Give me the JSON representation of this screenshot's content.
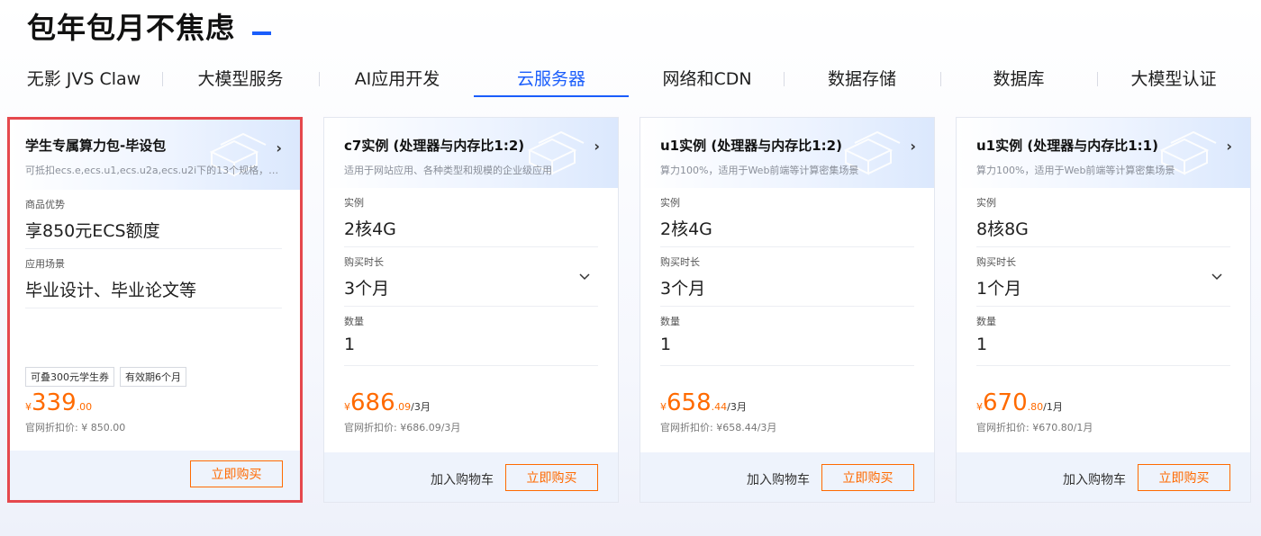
{
  "page": {
    "title": "包年包月不焦虑",
    "accent_color": "#1a5dfb",
    "price_color": "#ff6a00"
  },
  "tabs": [
    {
      "label": "无影 JVS Claw",
      "active": false
    },
    {
      "label": "大模型服务",
      "active": false
    },
    {
      "label": "AI应用开发",
      "active": false
    },
    {
      "label": "云服务器",
      "active": true
    },
    {
      "label": "网络和CDN",
      "active": false
    },
    {
      "label": "数据存储",
      "active": false
    },
    {
      "label": "数据库",
      "active": false
    },
    {
      "label": "大模型认证",
      "active": false
    }
  ],
  "cards": [
    {
      "title": "学生专属算力包-毕设包",
      "subtitle": "可抵扣ecs.e,ecs.u1,ecs.u2a,ecs.u2i下的13个规格，最...",
      "fields": [
        {
          "label": "商品优势",
          "value": "享850元ECS额度"
        },
        {
          "label": "应用场景",
          "value": "毕业设计、毕业论文等"
        }
      ],
      "tags": [
        "可叠300元学生券",
        "有效期6个月"
      ],
      "price": {
        "currency": "¥",
        "int": "339",
        "dec": ".00",
        "unit": ""
      },
      "list_price": "官网折扣价: ¥ 850.00",
      "buy_label": "立即购买"
    },
    {
      "title": "c7实例 (处理器与内存比1:2)",
      "subtitle": "适用于网站应用、各种类型和规模的企业级应用",
      "fields": [
        {
          "label": "实例",
          "value": "2核4G"
        },
        {
          "label": "购买时长",
          "value": "3个月"
        },
        {
          "label": "数量",
          "value": "1"
        }
      ],
      "price": {
        "currency": "¥",
        "int": "686",
        "dec": ".09",
        "unit": "/3月"
      },
      "list_price": "官网折扣价: ¥686.09/3月",
      "cart_label": "加入购物车",
      "buy_label": "立即购买"
    },
    {
      "title": "u1实例 (处理器与内存比1:2)",
      "subtitle": "算力100%，适用于Web前端等计算密集场景",
      "fields": [
        {
          "label": "实例",
          "value": "2核4G"
        },
        {
          "label": "购买时长",
          "value": "3个月"
        },
        {
          "label": "数量",
          "value": "1"
        }
      ],
      "price": {
        "currency": "¥",
        "int": "658",
        "dec": ".44",
        "unit": "/3月"
      },
      "list_price": "官网折扣价: ¥658.44/3月",
      "cart_label": "加入购物车",
      "buy_label": "立即购买"
    },
    {
      "title": "u1实例 (处理器与内存比1:1)",
      "subtitle": "算力100%，适用于Web前端等计算密集场景",
      "fields": [
        {
          "label": "实例",
          "value": "8核8G"
        },
        {
          "label": "购买时长",
          "value": "1个月"
        },
        {
          "label": "数量",
          "value": "1"
        }
      ],
      "price": {
        "currency": "¥",
        "int": "670",
        "dec": ".80",
        "unit": "/1月"
      },
      "list_price": "官网折扣价: ¥670.80/1月",
      "cart_label": "加入购物车",
      "buy_label": "立即购买"
    }
  ]
}
